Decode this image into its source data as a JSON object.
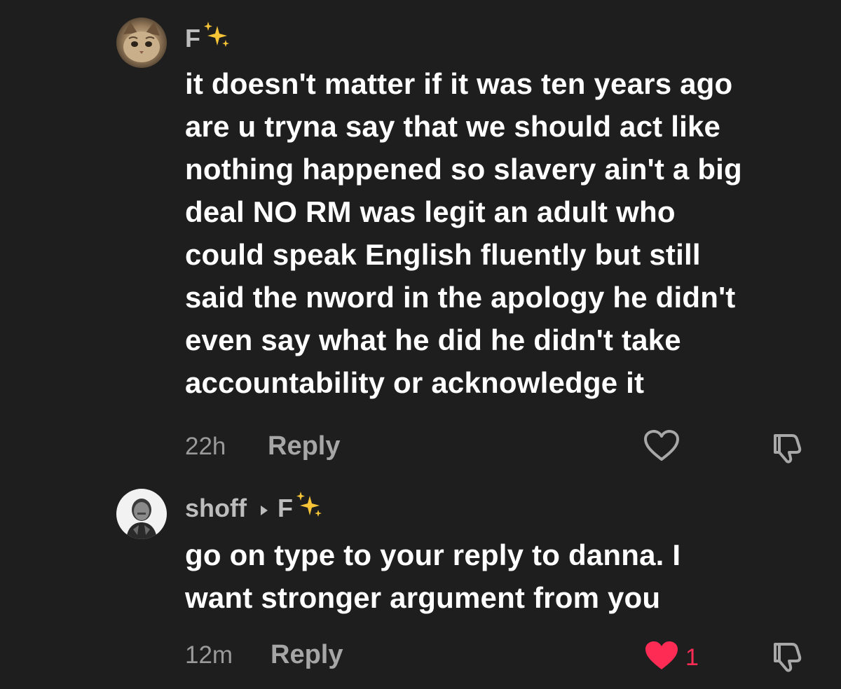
{
  "comments": [
    {
      "username": "F",
      "username_emoji": "sparkles",
      "body_lines": [
        "it doesn't matter if it was ten years ago",
        "are u tryna say that we should act like",
        "nothing happened so slavery ain't a big",
        "deal NO RM was legit an adult who",
        "could speak English fluently but still",
        "said the nword in the apology he didn't",
        "even say what he did he didn't take",
        "accountability or acknowledge it"
      ],
      "timestamp": "22h",
      "reply_label": "Reply",
      "liked": false,
      "like_count": ""
    },
    {
      "username": "shoff",
      "reply_to": "F",
      "reply_to_emoji": "sparkles",
      "body_lines": [
        "go on type to your reply to danna. I",
        "want stronger argument from you"
      ],
      "timestamp": "12m",
      "reply_label": "Reply",
      "liked": true,
      "like_count": "1"
    }
  ],
  "colors": {
    "background": "#1e1e1e",
    "text": "#ffffff",
    "muted": "#9a9a9a",
    "like_active": "#fe2c55"
  },
  "icons": [
    "heart-outline-icon",
    "heart-filled-icon",
    "dislike-icon",
    "reply-arrow-icon",
    "sparkles-icon"
  ]
}
